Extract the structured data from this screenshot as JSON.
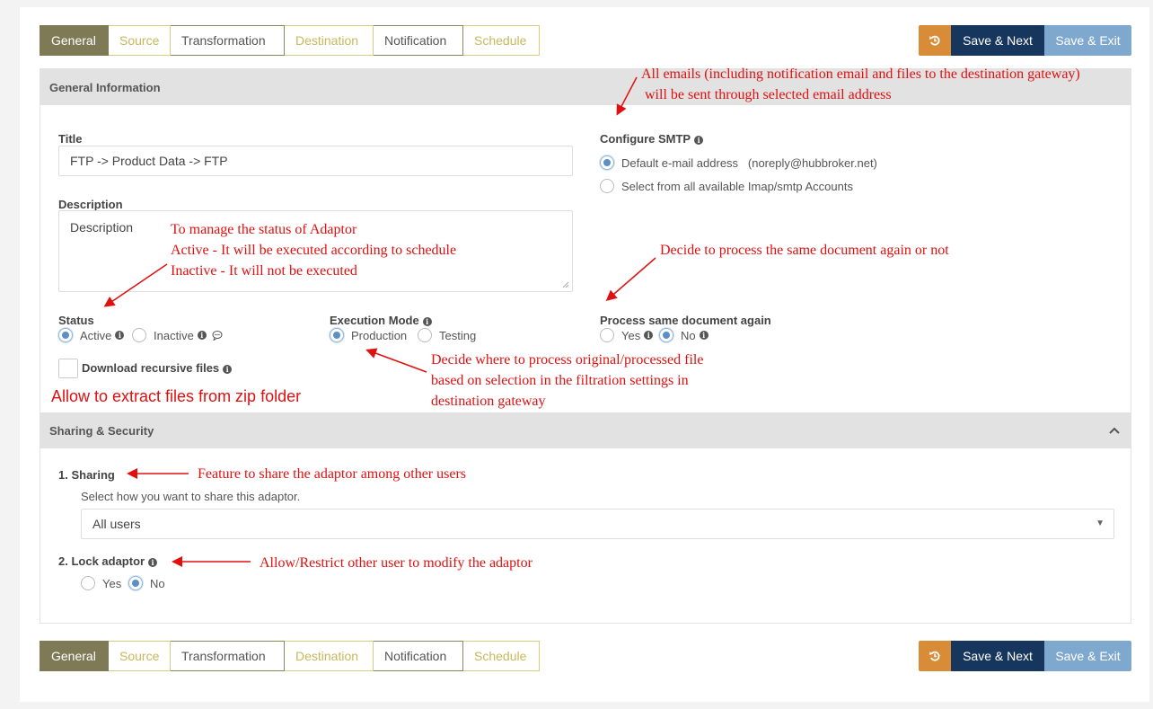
{
  "tabs": [
    {
      "label": "General",
      "state": "active"
    },
    {
      "label": "Source",
      "state": "pending"
    },
    {
      "label": "Transformation",
      "state": "done"
    },
    {
      "label": "Destination",
      "state": "pending"
    },
    {
      "label": "Notification",
      "state": "done"
    },
    {
      "label": "Schedule",
      "state": "pending"
    }
  ],
  "actions": {
    "reset_icon": "reset-icon",
    "save_next": "Save & Next",
    "save_exit": "Save & Exit"
  },
  "colors": {
    "tab_active": "#7d7a55",
    "reset": "#d98c38",
    "save_next": "#17365d",
    "save_exit": "#7fa8cf",
    "annotation": "#e01010",
    "radio_on": "#5b8fc6"
  },
  "general": {
    "heading": "General Information",
    "title_label": "Title",
    "title_value": "FTP  -> Product Data -> FTP",
    "description_label": "Description",
    "description_placeholder": "Description",
    "smtp_label": "Configure SMTP",
    "smtp_options": [
      "Default e-mail address   (noreply@hubbroker.net)",
      "Select from all available Imap/smtp Accounts"
    ],
    "smtp_selected": 0,
    "status_label": "Status",
    "status_options": [
      "Active",
      "Inactive"
    ],
    "status_selected": 0,
    "exec_label": "Execution Mode",
    "exec_options": [
      "Production",
      "Testing"
    ],
    "exec_selected": 0,
    "process_label": "Process same document again",
    "process_options": [
      "Yes",
      "No"
    ],
    "process_selected": 1,
    "download_label": "Download recursive files",
    "download_checked": false
  },
  "sharing": {
    "heading": "Sharing & Security",
    "sharing_label": "1. Sharing",
    "sharing_hint": "Select how you want to share this adaptor.",
    "sharing_value": "All users",
    "lock_label": "2. Lock adaptor",
    "lock_options": [
      "Yes",
      "No"
    ],
    "lock_selected": 1
  },
  "annotations": {
    "smtp_note_1": "All emails (including notification email and files to the destination gateway)",
    "smtp_note_2": "will be sent through selected email address",
    "status_note_1": "To manage the status of Adaptor",
    "status_note_2a": "Active - ",
    "status_note_2b": "It will be executed according to schedule",
    "status_note_3a": "Inactive - ",
    "status_note_3b": "It will not be executed",
    "process_note": "Decide to process the same document again or not",
    "exec_note_1": "Decide where to process original/processed file",
    "exec_note_2": "based on selection in the filtration settings in",
    "exec_note_3": "destination gateway",
    "zip_note": "Allow to extract files from zip folder",
    "sharing_note": "Feature to share the adaptor among other users",
    "lock_note": "Allow/Restrict other user to modify the adaptor"
  }
}
